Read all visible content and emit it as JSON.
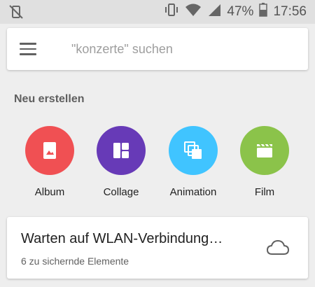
{
  "status": {
    "battery": "47%",
    "time": "17:56"
  },
  "search": {
    "placeholder": "\"konzerte\" suchen"
  },
  "create": {
    "title": "Neu erstellen",
    "items": [
      {
        "label": "Album",
        "color": "#f05053",
        "icon": "album-icon"
      },
      {
        "label": "Collage",
        "color": "#673ab7",
        "icon": "collage-icon"
      },
      {
        "label": "Animation",
        "color": "#40c4ff",
        "icon": "animation-icon"
      },
      {
        "label": "Film",
        "color": "#8bc34a",
        "icon": "film-icon"
      }
    ]
  },
  "backup_card": {
    "title": "Warten auf WLAN-Verbindung…",
    "subtitle": "6 zu sichernde Elemente",
    "icon": "cloud-icon"
  }
}
